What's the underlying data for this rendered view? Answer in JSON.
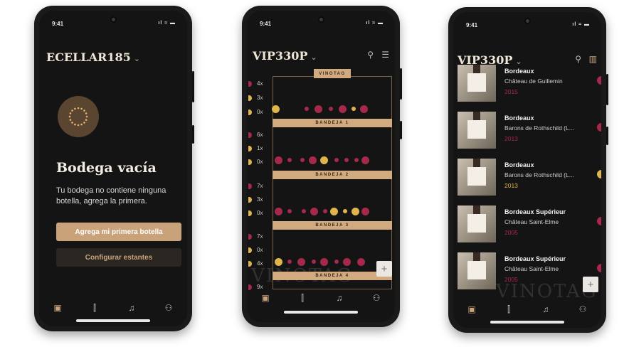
{
  "status": {
    "time": "9:41",
    "icons": "ıl ≈ ▬"
  },
  "colors": {
    "gold": "#c9a27a",
    "wine": "#a6294c",
    "bg": "#141414"
  },
  "phone1": {
    "title": "ECELLAR185",
    "chevron": "⌄",
    "empty_title": "Bodega vacía",
    "empty_desc": "Tu bodega no contiene ninguna botella, agrega la primera.",
    "primary_button": "Agrega mi primera botella",
    "secondary_button": "Configurar estantes"
  },
  "phone2": {
    "title": "VIP330P",
    "chevron": "⌄",
    "brand": "VINOTAG",
    "trays": [
      {
        "label": "BANDEJA 1",
        "counts": [
          "4x",
          "3x",
          "0x"
        ]
      },
      {
        "label": "BANDEJA 2",
        "counts": [
          "6x",
          "1x",
          "0x"
        ]
      },
      {
        "label": "BANDEJA 3",
        "counts": [
          "7x",
          "3x",
          "0x"
        ]
      },
      {
        "label": "BANDEJA 4",
        "counts": [
          "7x",
          "0x",
          "4x"
        ]
      }
    ],
    "extra_count": "9x",
    "fab": "+",
    "watermark": "VINOTAG"
  },
  "phone3": {
    "title": "VIP330P",
    "chevron": "⌄",
    "wines": [
      {
        "region": "Bordeaux",
        "name": "Château de Guillemin",
        "year": "2015",
        "year_color": "#a6294c",
        "mark_color": "#a6294c"
      },
      {
        "region": "Bordeaux",
        "name": "Barons de Rothschild (L...",
        "year": "2013",
        "year_color": "#a6294c",
        "mark_color": "#a6294c"
      },
      {
        "region": "Bordeaux",
        "name": "Barons de Rothschild (L...",
        "year": "2013",
        "year_color": "#e0b54c",
        "mark_color": "#e0b54c"
      },
      {
        "region": "Bordeaux Supérieur",
        "name": "Château Saint-Elme",
        "year": "2005",
        "year_color": "#a6294c",
        "mark_color": "#a6294c"
      },
      {
        "region": "Bordeaux Supérieur",
        "name": "Château Saint-Elme",
        "year": "2005",
        "year_color": "#a6294c",
        "mark_color": "#a6294c"
      }
    ],
    "fab": "+",
    "watermark": "VINOTAG"
  }
}
